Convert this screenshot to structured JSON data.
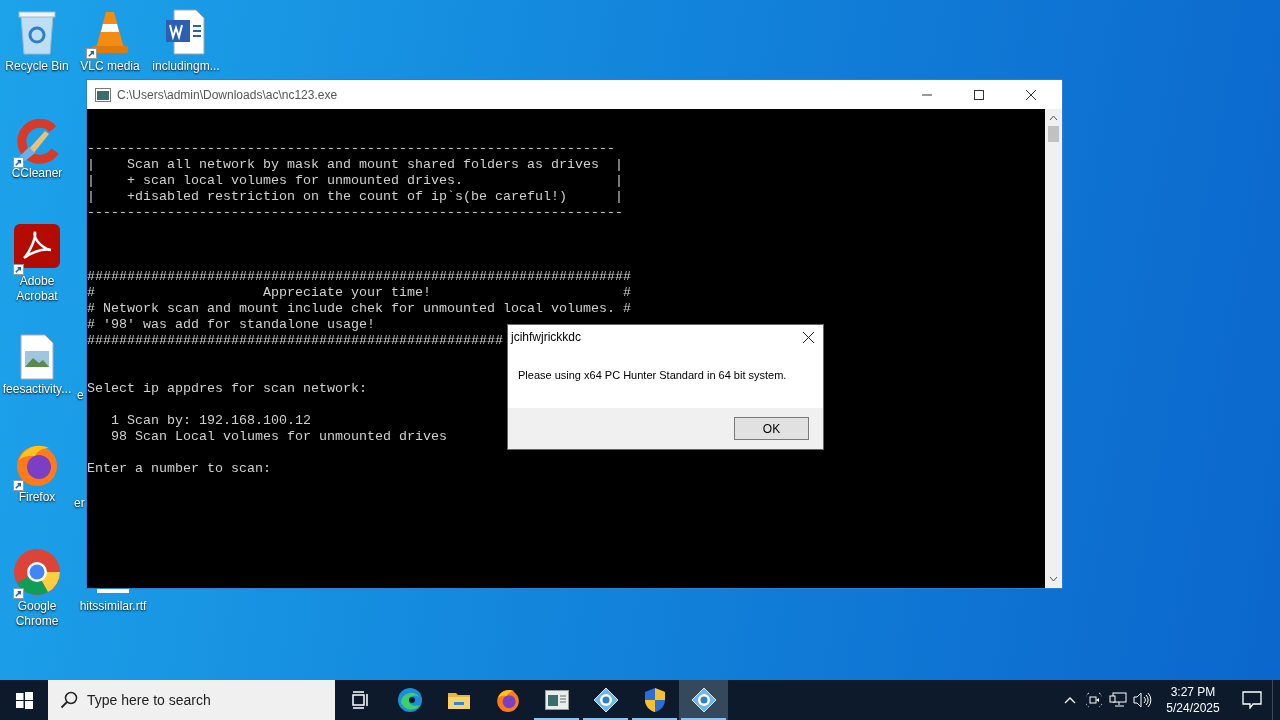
{
  "desktop_icons": [
    {
      "label": "Recycle Bin",
      "kind": "recycle",
      "shortcut": false
    },
    {
      "label": "VLC media",
      "kind": "vlc",
      "shortcut": true
    },
    {
      "label": "includingm...",
      "kind": "word",
      "shortcut": false
    },
    {
      "label": "CCleaner",
      "kind": "ccleaner",
      "shortcut": true
    },
    {
      "label": "Adobe Acrobat",
      "kind": "acrobat",
      "shortcut": true
    },
    {
      "label": "feesactivity...",
      "kind": "image-doc",
      "shortcut": false
    },
    {
      "label": "e",
      "kind": "hidden"
    },
    {
      "label": "Firefox",
      "kind": "firefox",
      "shortcut": true
    },
    {
      "label": "er",
      "kind": "hidden"
    },
    {
      "label": "Google Chrome",
      "kind": "chrome",
      "shortcut": true
    },
    {
      "label": "hitssimilar.rtf",
      "kind": "doc"
    }
  ],
  "console_window": {
    "title": "C:\\Users\\admin\\Downloads\\ac\\nc123.exe",
    "lines": [
      "------------------------------------------------------------------",
      "|    Scan all network by mask and mount shared folders as drives  |",
      "|    + scan local volumes for unmounted drives.                   |",
      "|    +disabled restriction on the count of ip`s(be careful!)      |",
      "-------------------------------------------------------------------",
      "####################################################################",
      "#                     Appreciate your time!                        #",
      "# Network scan and mount include chek for unmounted local volumes. #",
      "# '98' was add for standalone usage!",
      "####################################################",
      "Select ip appdres for scan network:",
      "   1 Scan by: 192.168.100.12",
      "   98 Scan Local volumes for unmounted drives",
      "Enter a number to scan:"
    ]
  },
  "dialog": {
    "title": "jcihfwjrickkdc",
    "message": "Please using x64 PC Hunter Standard in 64 bit system.",
    "button": "OK"
  },
  "taskbar": {
    "search_placeholder": "Type here to search",
    "apps": [
      {
        "kind": "taskview",
        "running": false,
        "active": false
      },
      {
        "kind": "edge",
        "running": false,
        "active": false
      },
      {
        "kind": "explorer",
        "running": false,
        "active": false
      },
      {
        "kind": "firefox",
        "running": false,
        "active": false
      },
      {
        "kind": "console",
        "running": true,
        "active": false
      },
      {
        "kind": "gear",
        "running": true,
        "active": false
      },
      {
        "kind": "shield",
        "running": true,
        "active": false
      },
      {
        "kind": "gear",
        "running": true,
        "active": true
      }
    ],
    "clock": {
      "time": "3:27 PM",
      "date": "5/24/2025"
    }
  }
}
